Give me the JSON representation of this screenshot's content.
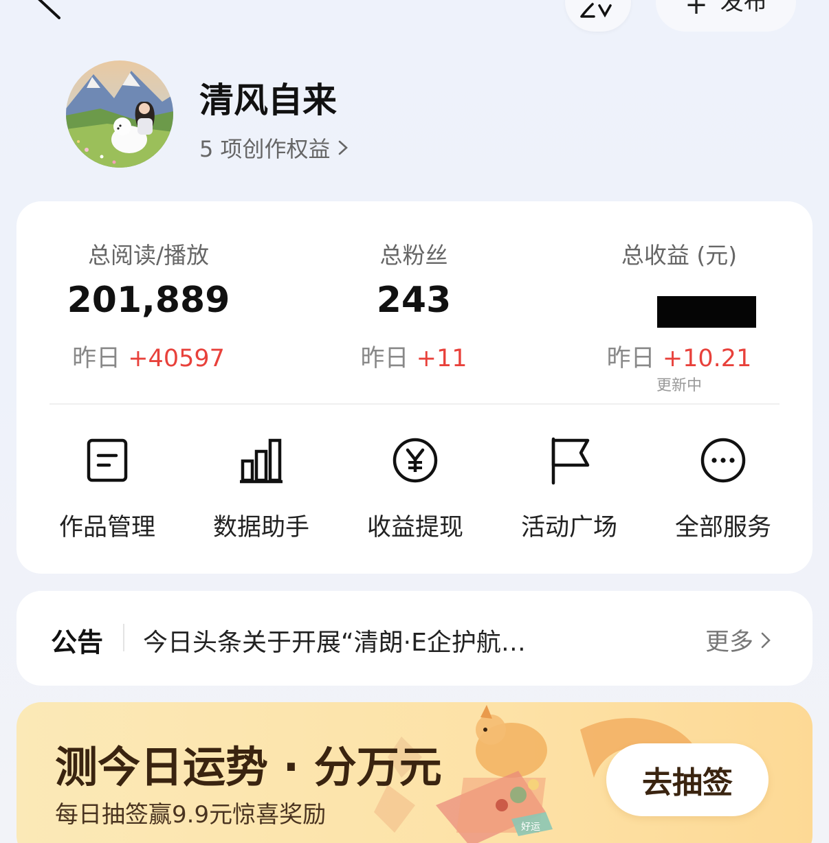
{
  "header": {
    "publish_label": "发布",
    "publish_plus": "+"
  },
  "profile": {
    "name": "清风自来",
    "rights_text": "5 项创作权益"
  },
  "stats": [
    {
      "label": "总阅读/播放",
      "value": "201,889",
      "yesterday_label": "昨日",
      "delta": "+40597"
    },
    {
      "label": "总粉丝",
      "value": "243",
      "yesterday_label": "昨日",
      "delta": "+11"
    },
    {
      "label": "总收益 (元)",
      "value": "",
      "yesterday_label": "昨日",
      "delta": "+10.21",
      "note": "更新中"
    }
  ],
  "services": [
    {
      "label": "作品管理",
      "icon": "document-icon"
    },
    {
      "label": "数据助手",
      "icon": "bar-chart-icon"
    },
    {
      "label": "收益提现",
      "icon": "yuan-coin-icon"
    },
    {
      "label": "活动广场",
      "icon": "flag-icon"
    },
    {
      "label": "全部服务",
      "icon": "more-dots-icon"
    }
  ],
  "notice": {
    "title": "公告",
    "text": "今日头条关于开展“清朗·E企护航”专项行动的公告",
    "more": "更多"
  },
  "banner": {
    "title": "测今日运势 · 分万元",
    "subtitle": "每日抽签赢9.9元惊喜奖励",
    "button": "去抽签",
    "tag": "好运"
  },
  "colors": {
    "delta_red": "#e8413b",
    "banner_bg": "#fde2a7"
  }
}
